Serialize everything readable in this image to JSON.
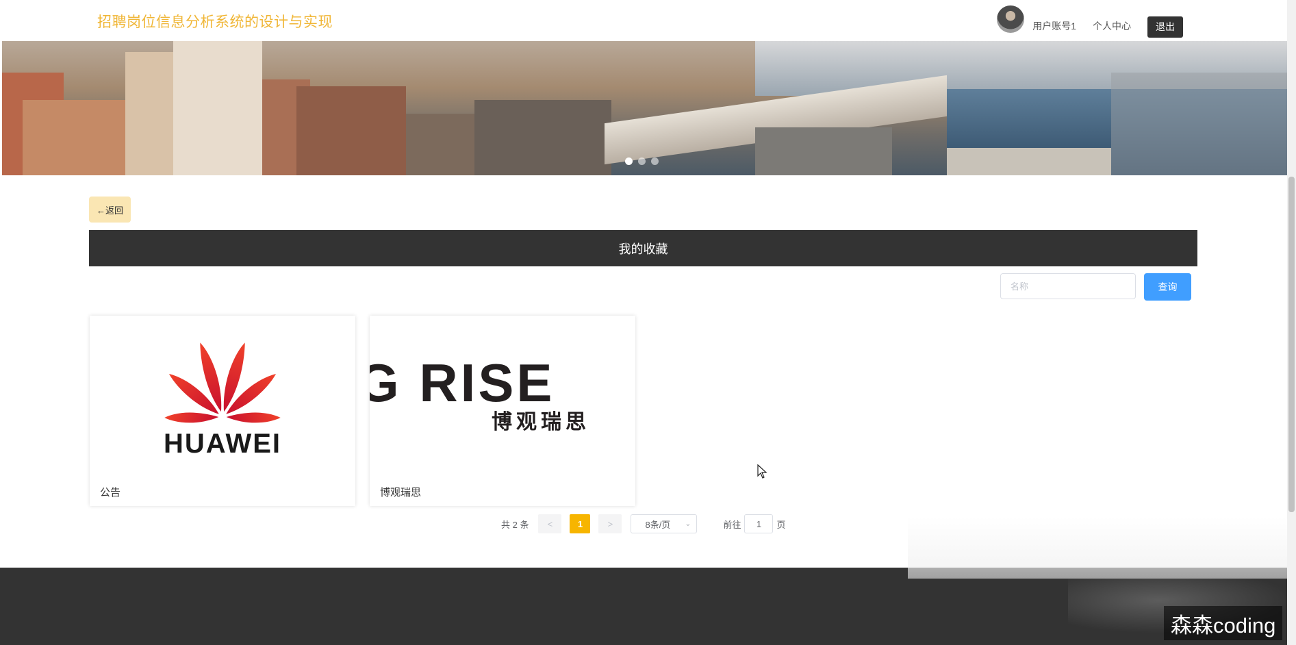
{
  "header": {
    "site_title": "招聘岗位信息分析系统的设计与实现",
    "username": "用户账号1",
    "personal_center": "个人中心",
    "logout": "退出"
  },
  "banner": {
    "slides": 3,
    "active_slide": 1
  },
  "back_button": "←返回",
  "section_title": "我的收藏",
  "search": {
    "placeholder": "名称",
    "button": "查询"
  },
  "cards": [
    {
      "caption": "公告",
      "logo": "huawei-logo",
      "logo_text": "HUAWEI"
    },
    {
      "caption": "博观瑞思",
      "logo": "rise-logo",
      "logo_text": "G RISE",
      "logo_subtext": "博观瑞思"
    }
  ],
  "pagination": {
    "total_text": "共 2 条",
    "prev": "<",
    "current_page": "1",
    "next": ">",
    "page_size": "8条/页",
    "goto_label": "前往",
    "goto_value": "1",
    "page_suffix": "页"
  },
  "watermark": "森森coding",
  "colors": {
    "title": "#f0b636",
    "dark_bar": "#333333",
    "accent": "#f7b500",
    "search_button": "#409eff",
    "back_button_bg": "#fae6b3"
  }
}
